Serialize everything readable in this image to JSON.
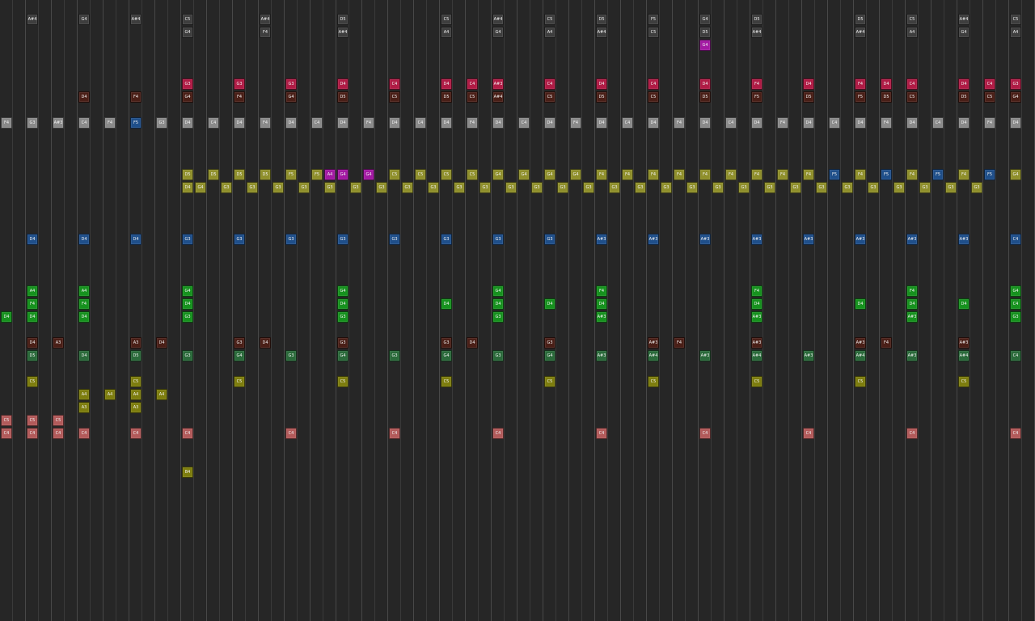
{
  "colors": {
    "background": "#262626",
    "grid": "#3a3a3a",
    "dkgray": "#3e3e3e",
    "gray": "#8a8a8a",
    "crimson": "#b01b45",
    "brown": "#4a1f17",
    "olive": "#8f8f2b",
    "magenta": "#a319a3",
    "blue": "#1f4f8a",
    "green": "#16921e",
    "dkgreen": "#2a6a3a",
    "yellow": "#7d7d0e",
    "rose": "#b25a5a"
  },
  "lanes": [
    {
      "name": "lane-0",
      "color": "dkgray",
      "row": 0,
      "notes": [
        [
          1,
          "A#4"
        ],
        [
          3,
          "G4"
        ],
        [
          5,
          "A#4"
        ],
        [
          7,
          "C5"
        ],
        [
          10,
          "A#4"
        ],
        [
          13,
          "D5"
        ],
        [
          17,
          "C5"
        ],
        [
          19,
          "A#4"
        ],
        [
          21,
          "C5"
        ],
        [
          23,
          "D5"
        ],
        [
          25,
          "F5"
        ],
        [
          27,
          "G4"
        ],
        [
          29,
          "D5"
        ],
        [
          33,
          "D5"
        ],
        [
          35,
          "C5"
        ],
        [
          37,
          "A#4"
        ],
        [
          39,
          "C5"
        ]
      ]
    },
    {
      "name": "lane-1",
      "color": "dkgray",
      "row": 1,
      "notes": [
        [
          7,
          "G4"
        ],
        [
          10,
          "F4"
        ],
        [
          13,
          "A#4"
        ],
        [
          17,
          "A4"
        ],
        [
          19,
          "G4"
        ],
        [
          21,
          "A4"
        ],
        [
          23,
          "A#4"
        ],
        [
          25,
          "C5"
        ],
        [
          27,
          "D5"
        ],
        [
          29,
          "A#4"
        ],
        [
          33,
          "A#4"
        ],
        [
          35,
          "A4"
        ],
        [
          37,
          "G4"
        ],
        [
          39,
          "A4"
        ]
      ]
    },
    {
      "name": "lane-2",
      "color": "magenta",
      "row": 2,
      "notes": [
        [
          27,
          "G4"
        ]
      ]
    },
    {
      "name": "lane-3",
      "color": "crimson",
      "row": 5,
      "notes": [
        [
          7,
          "G3"
        ],
        [
          9,
          "G3"
        ],
        [
          11,
          "G3"
        ],
        [
          13,
          "D4"
        ],
        [
          15,
          "C4"
        ],
        [
          17,
          "D4"
        ],
        [
          18,
          "C4"
        ],
        [
          19,
          "A#3"
        ],
        [
          21,
          "C4"
        ],
        [
          23,
          "D4"
        ],
        [
          25,
          "C4"
        ],
        [
          27,
          "D4"
        ],
        [
          29,
          "F4"
        ],
        [
          31,
          "D4"
        ],
        [
          33,
          "F4"
        ],
        [
          34,
          "D4"
        ],
        [
          35,
          "C4"
        ],
        [
          37,
          "D4"
        ],
        [
          38,
          "C4"
        ],
        [
          39,
          "G3"
        ]
      ]
    },
    {
      "name": "lane-4",
      "color": "brown",
      "row": 6,
      "notes": [
        [
          3,
          "D4"
        ],
        [
          5,
          "F4"
        ],
        [
          7,
          "G4"
        ],
        [
          9,
          "F4"
        ],
        [
          11,
          "G4"
        ],
        [
          13,
          "D5"
        ],
        [
          15,
          "C5"
        ],
        [
          17,
          "D5"
        ],
        [
          18,
          "C5"
        ],
        [
          19,
          "A#4"
        ],
        [
          21,
          "C5"
        ],
        [
          23,
          "D5"
        ],
        [
          25,
          "C5"
        ],
        [
          27,
          "D5"
        ],
        [
          29,
          "F5"
        ],
        [
          31,
          "D5"
        ],
        [
          33,
          "F5"
        ],
        [
          34,
          "D5"
        ],
        [
          35,
          "C5"
        ],
        [
          37,
          "D5"
        ],
        [
          38,
          "C5"
        ],
        [
          39,
          "G4"
        ]
      ]
    },
    {
      "name": "lane-5",
      "color": "gray",
      "row": 8,
      "notes": [
        [
          0,
          "F4"
        ],
        [
          1,
          "G3"
        ],
        [
          2,
          "A#3"
        ],
        [
          3,
          "C4"
        ],
        [
          4,
          "F4"
        ],
        [
          6,
          "G3"
        ],
        [
          7,
          "D4"
        ],
        [
          8,
          "C4"
        ],
        [
          9,
          "D4"
        ],
        [
          10,
          "F4"
        ],
        [
          11,
          "D4"
        ],
        [
          12,
          "C4"
        ],
        [
          13,
          "D4"
        ],
        [
          14,
          "F4"
        ],
        [
          15,
          "D4"
        ],
        [
          16,
          "C4"
        ],
        [
          17,
          "D4"
        ],
        [
          18,
          "F4"
        ],
        [
          19,
          "D4"
        ],
        [
          20,
          "C4"
        ],
        [
          21,
          "D4"
        ],
        [
          22,
          "F4"
        ],
        [
          23,
          "D4"
        ],
        [
          24,
          "C4"
        ],
        [
          25,
          "D4"
        ],
        [
          26,
          "F4"
        ],
        [
          27,
          "D4"
        ],
        [
          28,
          "C4"
        ],
        [
          29,
          "D4"
        ],
        [
          30,
          "F4"
        ],
        [
          31,
          "D4"
        ],
        [
          32,
          "C4"
        ],
        [
          33,
          "D4"
        ],
        [
          34,
          "F4"
        ],
        [
          35,
          "D4"
        ],
        [
          36,
          "C4"
        ],
        [
          37,
          "D4"
        ],
        [
          38,
          "F4"
        ],
        [
          39,
          "D4"
        ]
      ]
    },
    {
      "name": "lane-6",
      "color": "blue",
      "row": 8,
      "notes": [
        [
          5,
          "F5"
        ]
      ]
    },
    {
      "name": "lane-7",
      "color": "olive",
      "row": 12,
      "notes": [
        [
          7,
          "D5"
        ],
        [
          8,
          "D5"
        ],
        [
          9,
          "D5"
        ],
        [
          10,
          "D5"
        ],
        [
          11,
          "F5"
        ],
        [
          12,
          "F5"
        ],
        [
          15,
          "C5"
        ],
        [
          16,
          "C5"
        ],
        [
          17,
          "C5"
        ],
        [
          18,
          "C5"
        ],
        [
          19,
          "G4"
        ],
        [
          20,
          "G4"
        ],
        [
          21,
          "G4"
        ],
        [
          22,
          "G4"
        ],
        [
          23,
          "F4"
        ],
        [
          24,
          "F4"
        ],
        [
          25,
          "F4"
        ],
        [
          26,
          "F4"
        ],
        [
          27,
          "F4"
        ],
        [
          28,
          "F4"
        ],
        [
          29,
          "F4"
        ],
        [
          30,
          "F4"
        ],
        [
          31,
          "F4"
        ],
        [
          33,
          "F4"
        ],
        [
          35,
          "F4"
        ],
        [
          37,
          "F4"
        ],
        [
          39,
          "G4"
        ]
      ]
    },
    {
      "name": "lane-8",
      "color": "magenta",
      "row": 12,
      "notes": [
        [
          12.5,
          "A4"
        ],
        [
          13,
          "G4"
        ],
        [
          14,
          "G4"
        ]
      ]
    },
    {
      "name": "lane-9",
      "color": "blue",
      "row": 12,
      "notes": [
        [
          32,
          "F5"
        ],
        [
          34,
          "F5"
        ],
        [
          36,
          "F5"
        ],
        [
          38,
          "F5"
        ]
      ]
    },
    {
      "name": "lane-10",
      "color": "olive",
      "row": 13,
      "notes": [
        [
          7,
          "D4"
        ],
        [
          7.5,
          "G4"
        ],
        [
          8.5,
          "G3"
        ],
        [
          9.5,
          "G3"
        ],
        [
          10.5,
          "G3"
        ],
        [
          11.5,
          "G3"
        ],
        [
          12.5,
          "G3"
        ],
        [
          13.5,
          "G3"
        ],
        [
          14.5,
          "G3"
        ],
        [
          15.5,
          "G3"
        ],
        [
          16.5,
          "G3"
        ],
        [
          17.5,
          "G3"
        ],
        [
          18.5,
          "G3"
        ],
        [
          19.5,
          "G3"
        ],
        [
          20.5,
          "G3"
        ],
        [
          21.5,
          "G3"
        ],
        [
          22.5,
          "G3"
        ],
        [
          23.5,
          "G3"
        ],
        [
          24.5,
          "G3"
        ],
        [
          25.5,
          "G3"
        ],
        [
          26.5,
          "G3"
        ],
        [
          27.5,
          "G3"
        ],
        [
          28.5,
          "G3"
        ],
        [
          29.5,
          "G3"
        ],
        [
          30.5,
          "G3"
        ],
        [
          31.5,
          "G3"
        ],
        [
          32.5,
          "G3"
        ],
        [
          33.5,
          "G3"
        ],
        [
          34.5,
          "G3"
        ],
        [
          35.5,
          "G3"
        ],
        [
          36.5,
          "G3"
        ],
        [
          37.5,
          "G3"
        ]
      ]
    },
    {
      "name": "lane-11",
      "color": "blue",
      "row": 17,
      "notes": [
        [
          1,
          "D4"
        ],
        [
          3,
          "D4"
        ],
        [
          5,
          "D4"
        ],
        [
          7,
          "G3"
        ],
        [
          9,
          "G3"
        ],
        [
          11,
          "G3"
        ],
        [
          13,
          "G3"
        ],
        [
          15,
          "G3"
        ],
        [
          17,
          "G3"
        ],
        [
          19,
          "G3"
        ],
        [
          21,
          "G3"
        ],
        [
          23,
          "A#3"
        ],
        [
          25,
          "A#3"
        ],
        [
          27,
          "A#3"
        ],
        [
          29,
          "A#3"
        ],
        [
          31,
          "A#3"
        ],
        [
          33,
          "A#3"
        ],
        [
          35,
          "A#3"
        ],
        [
          37,
          "A#3"
        ],
        [
          39,
          "C4"
        ]
      ]
    },
    {
      "name": "lane-12",
      "color": "green",
      "row": 21,
      "notes": [
        [
          1,
          "A4"
        ],
        [
          3,
          "A4"
        ],
        [
          7,
          "G4"
        ],
        [
          13,
          "G4"
        ],
        [
          19,
          "G4"
        ],
        [
          23,
          "F4"
        ],
        [
          29,
          "F4"
        ],
        [
          35,
          "F4"
        ],
        [
          39,
          "G4"
        ]
      ]
    },
    {
      "name": "lane-13",
      "color": "green",
      "row": 22,
      "notes": [
        [
          1,
          "F4"
        ],
        [
          3,
          "F4"
        ],
        [
          7,
          "D4"
        ],
        [
          13,
          "D4"
        ],
        [
          17,
          "D4"
        ],
        [
          19,
          "D4"
        ],
        [
          21,
          "D4"
        ],
        [
          23,
          "D4"
        ],
        [
          29,
          "D4"
        ],
        [
          33,
          "D4"
        ],
        [
          35,
          "D4"
        ],
        [
          37,
          "D4"
        ],
        [
          39,
          "C4"
        ]
      ]
    },
    {
      "name": "lane-14",
      "color": "green",
      "row": 23,
      "notes": [
        [
          0,
          "D4"
        ],
        [
          1,
          "D4"
        ],
        [
          3,
          "D4"
        ],
        [
          7,
          "G3"
        ],
        [
          13,
          "G3"
        ],
        [
          19,
          "G3"
        ],
        [
          23,
          "A#3"
        ],
        [
          29,
          "A#3"
        ],
        [
          35,
          "A#3"
        ],
        [
          39,
          "G3"
        ]
      ]
    },
    {
      "name": "lane-15",
      "color": "brown",
      "row": 25,
      "notes": [
        [
          1,
          "D4"
        ],
        [
          2,
          "A3"
        ],
        [
          5,
          "A3"
        ],
        [
          6,
          "D4"
        ],
        [
          9,
          "G3"
        ],
        [
          10,
          "D4"
        ],
        [
          13,
          "G3"
        ],
        [
          17,
          "G3"
        ],
        [
          18,
          "D4"
        ],
        [
          21,
          "G3"
        ],
        [
          25,
          "A#3"
        ],
        [
          26,
          "F4"
        ],
        [
          29,
          "A#3"
        ],
        [
          33,
          "A#3"
        ],
        [
          34,
          "F4"
        ],
        [
          37,
          "A#3"
        ]
      ]
    },
    {
      "name": "lane-16",
      "color": "dkgreen",
      "row": 26,
      "notes": [
        [
          1,
          "D5"
        ],
        [
          3,
          "D4"
        ],
        [
          5,
          "D5"
        ],
        [
          7,
          "G3"
        ],
        [
          9,
          "G4"
        ],
        [
          11,
          "G3"
        ],
        [
          13,
          "G4"
        ],
        [
          15,
          "G3"
        ],
        [
          17,
          "G4"
        ],
        [
          19,
          "G3"
        ],
        [
          21,
          "G4"
        ],
        [
          23,
          "A#3"
        ],
        [
          25,
          "A#4"
        ],
        [
          27,
          "A#3"
        ],
        [
          29,
          "A#4"
        ],
        [
          31,
          "A#3"
        ],
        [
          33,
          "A#4"
        ],
        [
          35,
          "A#3"
        ],
        [
          37,
          "A#4"
        ],
        [
          39,
          "C4"
        ]
      ]
    },
    {
      "name": "lane-17",
      "color": "yellow",
      "row": 28,
      "notes": [
        [
          1,
          "C5"
        ],
        [
          5,
          "C5"
        ],
        [
          9,
          "C5"
        ],
        [
          13,
          "C5"
        ],
        [
          17,
          "C5"
        ],
        [
          21,
          "C5"
        ],
        [
          25,
          "C5"
        ],
        [
          29,
          "C5"
        ],
        [
          33,
          "C5"
        ],
        [
          37,
          "C5"
        ]
      ]
    },
    {
      "name": "lane-18",
      "color": "yellow",
      "row": 29,
      "notes": [
        [
          3,
          "A4"
        ],
        [
          4,
          "A4"
        ],
        [
          5,
          "A4"
        ],
        [
          6,
          "A4"
        ]
      ]
    },
    {
      "name": "lane-19",
      "color": "yellow",
      "row": 30,
      "notes": [
        [
          3,
          "A3"
        ],
        [
          5,
          "A3"
        ]
      ]
    },
    {
      "name": "lane-20",
      "color": "rose",
      "row": 31,
      "notes": [
        [
          0,
          "C5"
        ],
        [
          1,
          "C5"
        ],
        [
          2,
          "C5"
        ]
      ]
    },
    {
      "name": "lane-21",
      "color": "rose",
      "row": 32,
      "notes": [
        [
          0,
          "C4"
        ],
        [
          1,
          "C4"
        ],
        [
          2,
          "C4"
        ],
        [
          3,
          "C4"
        ],
        [
          5,
          "C4"
        ],
        [
          7,
          "C4"
        ],
        [
          11,
          "C4"
        ],
        [
          15,
          "C4"
        ],
        [
          19,
          "C4"
        ],
        [
          23,
          "C4"
        ],
        [
          27,
          "C4"
        ],
        [
          31,
          "C4"
        ],
        [
          35,
          "C4"
        ],
        [
          39,
          "C4"
        ]
      ]
    },
    {
      "name": "lane-22",
      "color": "yellow",
      "row": 35,
      "notes": [
        [
          7,
          "B4"
        ]
      ]
    }
  ]
}
